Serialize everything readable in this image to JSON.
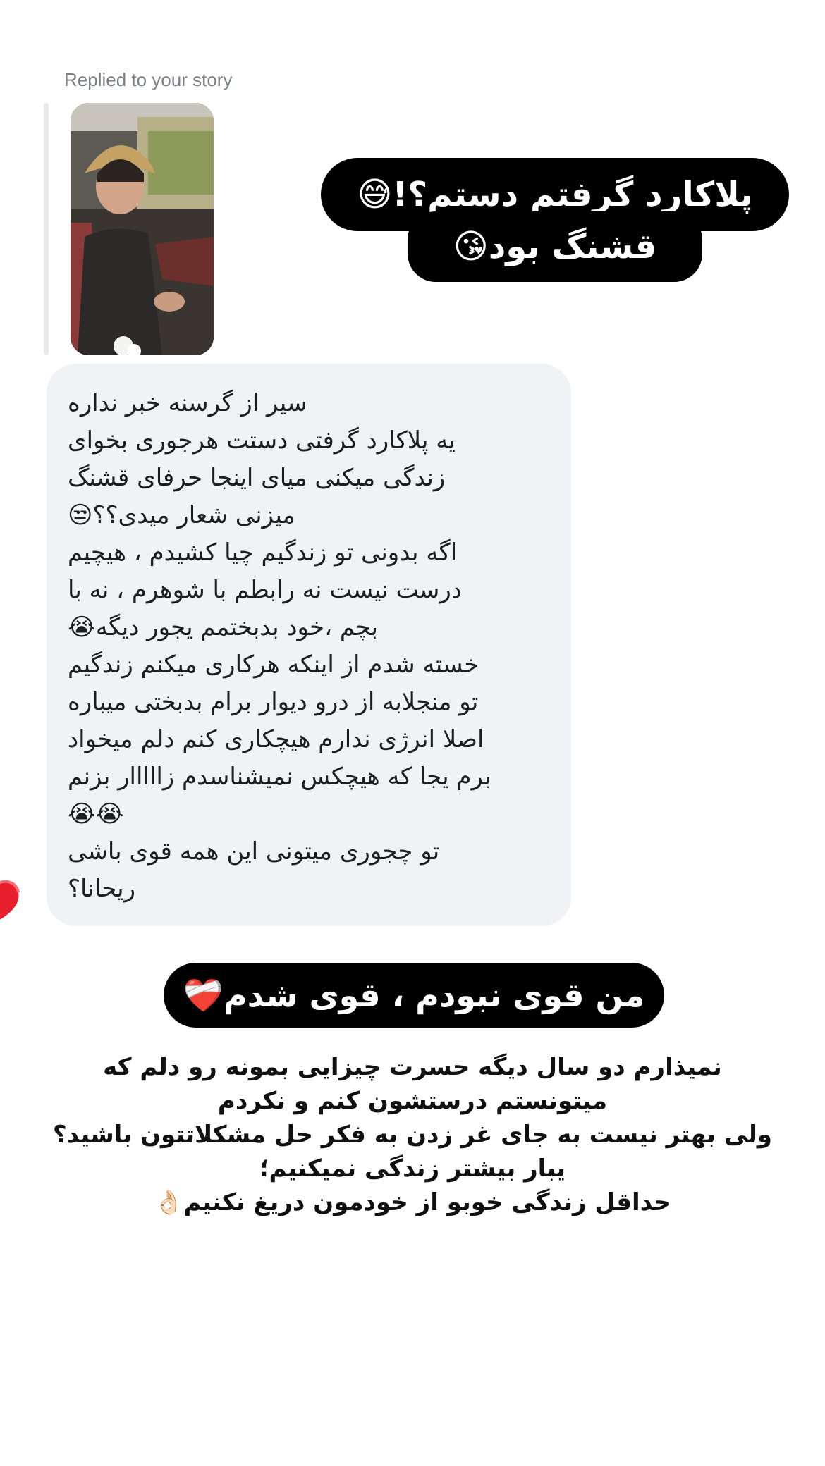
{
  "reply_header": {
    "label": "Replied to your story"
  },
  "story_caption": {
    "line1": "پلاکارد گرفتم دستم؟!😅",
    "line2": "قشنگ بود😘"
  },
  "message": {
    "lines": [
      "سیر از گرسنه خبر نداره",
      "یه پلاکارد گرفتی دستت هرجوری بخوای",
      "زندگی میکنی میای اینجا حرفای قشنگ",
      "میزنی شعار میدی؟؟😒",
      "اگه بدونی تو زندگیم چیا کشیدم ، هیچیم",
      "درست نیست نه رابطم با شوهرم ، نه با",
      "بچم ،خود بدبختمم یجور دیگه😭",
      "خسته شدم از اینکه هرکاری میکنم زندگیم",
      "تو منجلابه از درو دیوار برام بدبختی میباره",
      "اصلا انرژی ندارم هیچکاری کنم دلم میخواد",
      "برم یجا که هیچکس نمیشناسدم زااااار بزنم",
      "😭😭",
      "تو چجوری میتونی این همه قوی باشی",
      "ریحانا؟"
    ],
    "reaction_icon": "heart-icon"
  },
  "answer_caption": {
    "text": "من قوی نبودم ، قوی شدم❤️‍🩹"
  },
  "answer_body": {
    "lines": [
      "نمیذارم دو سال دیگه حسرت چیزایی بمونه رو دلم که",
      "میتونستم درستشون کنم و نکردم",
      "ولی بهتر نیست به جای غر زدن به فکر حل مشکلاتتون باشید؟",
      "یبار بیشتر زندگی نمیکنیم؛",
      "حداقل زندگی خوبو از خودمون دریغ نکنیم👌🏻"
    ]
  },
  "colors": {
    "caption_bg": "#000000",
    "caption_text": "#ffffff",
    "bubble_bg": "#f1f2f5",
    "reaction_heart": "#e8202d"
  }
}
